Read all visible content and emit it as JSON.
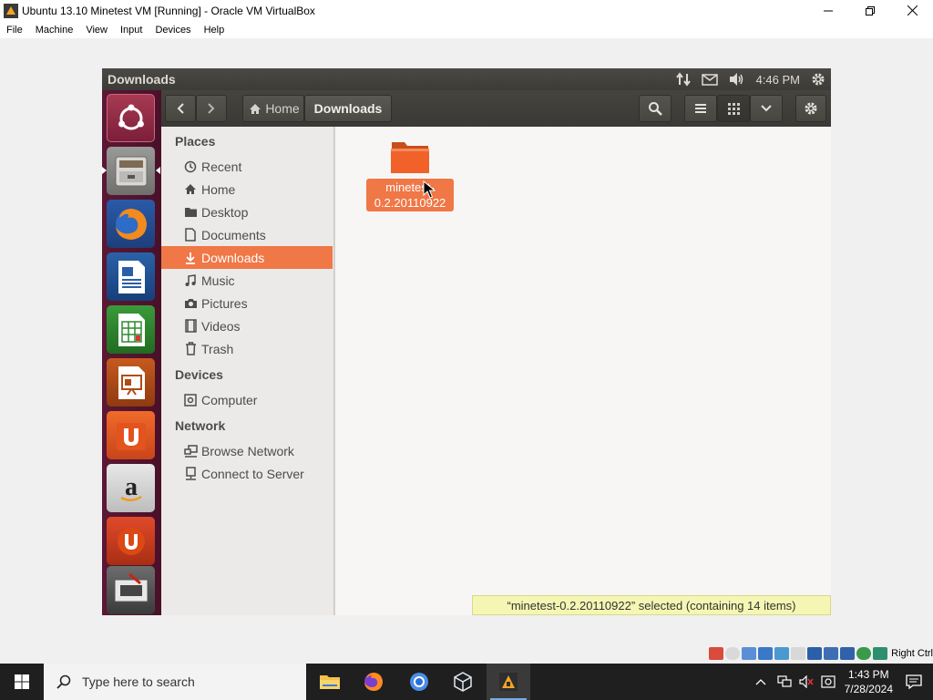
{
  "host": {
    "title": "Ubuntu 13.10 Minetest VM [Running] - Oracle VM VirtualBox",
    "menu": [
      "File",
      "Machine",
      "View",
      "Input",
      "Devices",
      "Help"
    ],
    "status_key": "Right Ctrl"
  },
  "guest": {
    "panel_title": "Downloads",
    "clock": "4:46 PM",
    "breadcrumb": {
      "home": "Home",
      "current": "Downloads"
    },
    "sidebar": {
      "places_heading": "Places",
      "places": [
        {
          "label": "Recent",
          "icon": "clock-icon"
        },
        {
          "label": "Home",
          "icon": "home-icon"
        },
        {
          "label": "Desktop",
          "icon": "folder-icon"
        },
        {
          "label": "Documents",
          "icon": "document-icon"
        },
        {
          "label": "Downloads",
          "icon": "download-icon",
          "selected": true
        },
        {
          "label": "Music",
          "icon": "music-icon"
        },
        {
          "label": "Pictures",
          "icon": "camera-icon"
        },
        {
          "label": "Videos",
          "icon": "film-icon"
        },
        {
          "label": "Trash",
          "icon": "trash-icon"
        }
      ],
      "devices_heading": "Devices",
      "devices": [
        {
          "label": "Computer",
          "icon": "drive-icon"
        }
      ],
      "network_heading": "Network",
      "network": [
        {
          "label": "Browse Network",
          "icon": "network-icon"
        },
        {
          "label": "Connect to Server",
          "icon": "server-icon"
        }
      ]
    },
    "files": [
      {
        "name": "minetest-0.2.20110922",
        "type": "folder"
      }
    ],
    "status": "“minetest-0.2.20110922” selected (containing 14 items)"
  },
  "taskbar": {
    "search_placeholder": "Type here to search",
    "time": "1:43 PM",
    "date": "7/28/2024"
  },
  "colors": {
    "accent": "#f07746",
    "launcher": "#5b1834",
    "panel": "#3c3b37"
  }
}
